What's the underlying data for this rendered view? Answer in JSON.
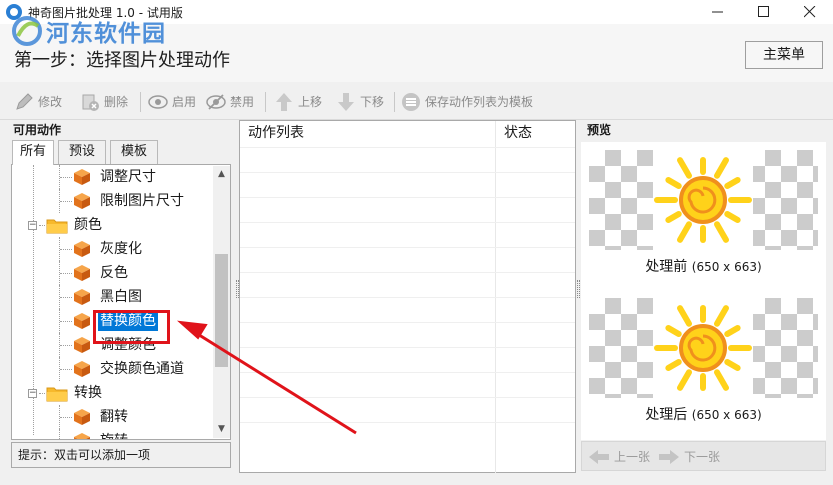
{
  "window": {
    "title": "神奇图片批处理 1.0 - 试用版",
    "minimize_glyph": "—",
    "maximize_glyph": "□",
    "close_glyph": "✕"
  },
  "watermark": {
    "text": "河东软件园"
  },
  "header": {
    "step_title": "第一步：选择图片处理动作",
    "main_menu_label": "主菜单"
  },
  "toolbar": {
    "edit": "修改",
    "delete": "删除",
    "enable": "启用",
    "disable": "禁用",
    "move_up": "上移",
    "move_down": "下移",
    "save_template": "保存动作列表为模板"
  },
  "left_panel": {
    "title": "可用动作",
    "tabs": [
      "所有",
      "预设",
      "模板"
    ],
    "active_tab": "所有",
    "tree": [
      {
        "label": "调整尺寸",
        "type": "action"
      },
      {
        "label": "限制图片尺寸",
        "type": "action"
      },
      {
        "label": "颜色",
        "type": "folder",
        "expanded": true
      },
      {
        "label": "灰度化",
        "type": "action"
      },
      {
        "label": "反色",
        "type": "action"
      },
      {
        "label": "黑白图",
        "type": "action"
      },
      {
        "label": "替换颜色",
        "type": "action",
        "selected": true
      },
      {
        "label": "调整颜色",
        "type": "action"
      },
      {
        "label": "交换颜色通道",
        "type": "action"
      },
      {
        "label": "转换",
        "type": "folder",
        "expanded": true
      },
      {
        "label": "翻转",
        "type": "action"
      },
      {
        "label": "旋转",
        "type": "action"
      }
    ],
    "hint": "提示：双击可以添加一项"
  },
  "action_list": {
    "columns": [
      "动作列表",
      "状态"
    ],
    "rows": []
  },
  "preview": {
    "title": "预览",
    "before_label": "处理前",
    "before_dims": "(650 x 663)",
    "after_label": "处理后",
    "after_dims": "(650 x 663)",
    "prev_label": "上一张",
    "next_label": "下一张"
  },
  "colors": {
    "selection": "#0078d7",
    "highlight_box": "#e0131a",
    "watermark": "#3f86d6",
    "sun_orange": "#f0901c",
    "sun_yellow": "#ffd21a"
  }
}
